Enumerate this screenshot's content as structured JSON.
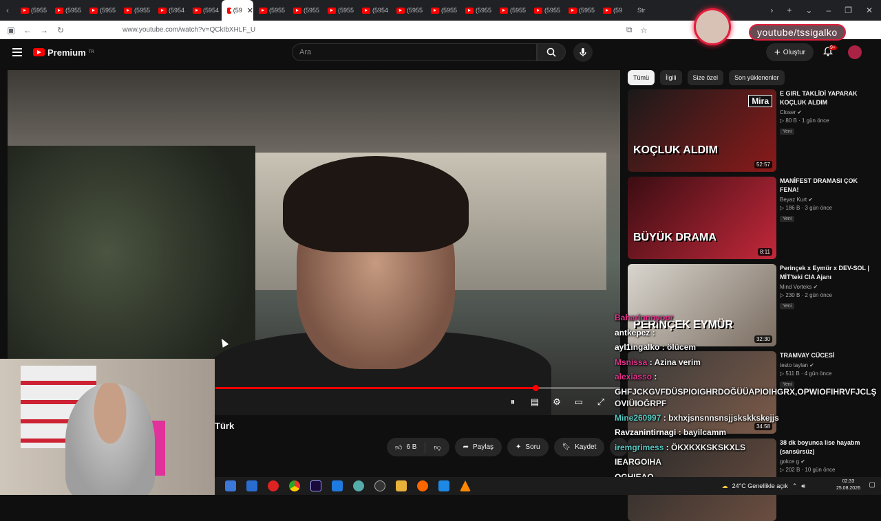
{
  "browser": {
    "tabs": [
      "(5955",
      "(5955",
      "(5955",
      "(5955",
      "(5954",
      "(5954",
      "(59",
      "(5955",
      "(5955",
      "(5955",
      "(5954",
      "(5955",
      "(5955",
      "(5955",
      "(5955",
      "(5955",
      "(5955",
      "(59"
    ],
    "active_tab_index": 6,
    "last_tab": "Str",
    "url": "www.youtube.com/watch?v=QCkIbXHLF_U"
  },
  "header": {
    "logo": "Premium",
    "logo_sup": "TR",
    "search_placeholder": "Ara",
    "create": "Oluştur",
    "notif_badge": "9+"
  },
  "streamer": {
    "handle": "youtube/tssigalko"
  },
  "video": {
    "title": "Türk",
    "progress": 0.79
  },
  "actions": {
    "like": "6 B",
    "share": "Paylaş",
    "ask": "Soru",
    "save": "Kaydet"
  },
  "chips": [
    "Tümü",
    "İlgili",
    "Size özel",
    "Son yüklenenler"
  ],
  "recommendations": [
    {
      "title": "E GIRL TAKLİDİ YAPARAK KOÇLUK ALDIM",
      "channel": "Closer",
      "views": "80 B",
      "age": "1 gün önce",
      "badge": "Yeni",
      "duration": "52:57",
      "thumb_text": "KOÇLUK ALDIM",
      "thumb_tag": "Mira",
      "thumb_colors": [
        "#1a1a1a",
        "#8b1a1a"
      ]
    },
    {
      "title": "MANİFEST DRAMASI ÇOK FENA!",
      "channel": "Beyaz Kurt",
      "views": "186 B",
      "age": "3 gün önce",
      "badge": "Yeni",
      "duration": "8:11",
      "thumb_text": "BÜYÜK DRAMA",
      "thumb_tag": "",
      "thumb_colors": [
        "#3a0d12",
        "#c3283a"
      ]
    },
    {
      "title": "Perinçek x Eymür x DEV-SOL | MİT'teki CIA Ajanı",
      "channel": "Mind Vorteks",
      "views": "230 B",
      "age": "2 gün önce",
      "badge": "Yeni",
      "duration": "32:30",
      "thumb_text": "PERİNÇEK EYMÜR",
      "thumb_tag": "",
      "thumb_colors": [
        "#d9d6cf",
        "#7a6c60"
      ]
    },
    {
      "title": "TRAMVAY CÜCESİ",
      "channel": "testo taylan",
      "views": "511 B",
      "age": "4 gün önce",
      "badge": "Yeni",
      "duration": "34:58",
      "thumb_text": "",
      "thumb_tag": "",
      "thumb_colors": [
        "#3a3a3a",
        "#7c5a48"
      ]
    },
    {
      "title": "38 dk boyunca lise hayatım (sansürsüz)",
      "channel": "gokce g",
      "views": "202 B",
      "age": "10 gün önce",
      "badge": "",
      "duration": "",
      "thumb_text": "",
      "thumb_tag": "",
      "thumb_colors": [
        "#2a2a2a",
        "#6b4e40"
      ]
    }
  ],
  "chat": [
    {
      "user": "Baharinnnyoor",
      "msg": "",
      "color": "#e0328a"
    },
    {
      "user": "antkepez",
      "msg": ":",
      "color": "#ffffff"
    },
    {
      "user": "ayl1ingalko",
      "msg": ": ölücem",
      "color": "#ffffff"
    },
    {
      "user": "Msnissa",
      "msg": ": Azina verim",
      "color": "#e0328a"
    },
    {
      "user": "alexiasso",
      "msg": ":",
      "color": "#e0328a"
    },
    {
      "user": "",
      "msg": "GHFJCKGVFDÜSPIOIGHRDOĞÜÜAPIOIHGRX,OPWIOFIHRVFJCLŞ OVIÜIOĞRPF",
      "color": "#ffffff"
    },
    {
      "user": "Mine260997",
      "msg": ": bxhxjsnsnnsnsjjskskkskejjs",
      "color": "#55c7c0"
    },
    {
      "user": "Ravzanintirnagi",
      "msg": ": bayilcamm",
      "color": "#ffffff"
    },
    {
      "user": "iremgrimess",
      "msg": ": ÖKXKXKSKSKXLS",
      "color": "#55c7c0"
    },
    {
      "user": "",
      "msg": "IEARGOIHA",
      "color": "#ffffff"
    },
    {
      "user": "",
      "msg": "OGHIEAO",
      "color": "#ffffff"
    }
  ],
  "taskbar": {
    "weather": "24°C  Genellikle açık",
    "time": "02:33",
    "date": "25.08.2026"
  }
}
